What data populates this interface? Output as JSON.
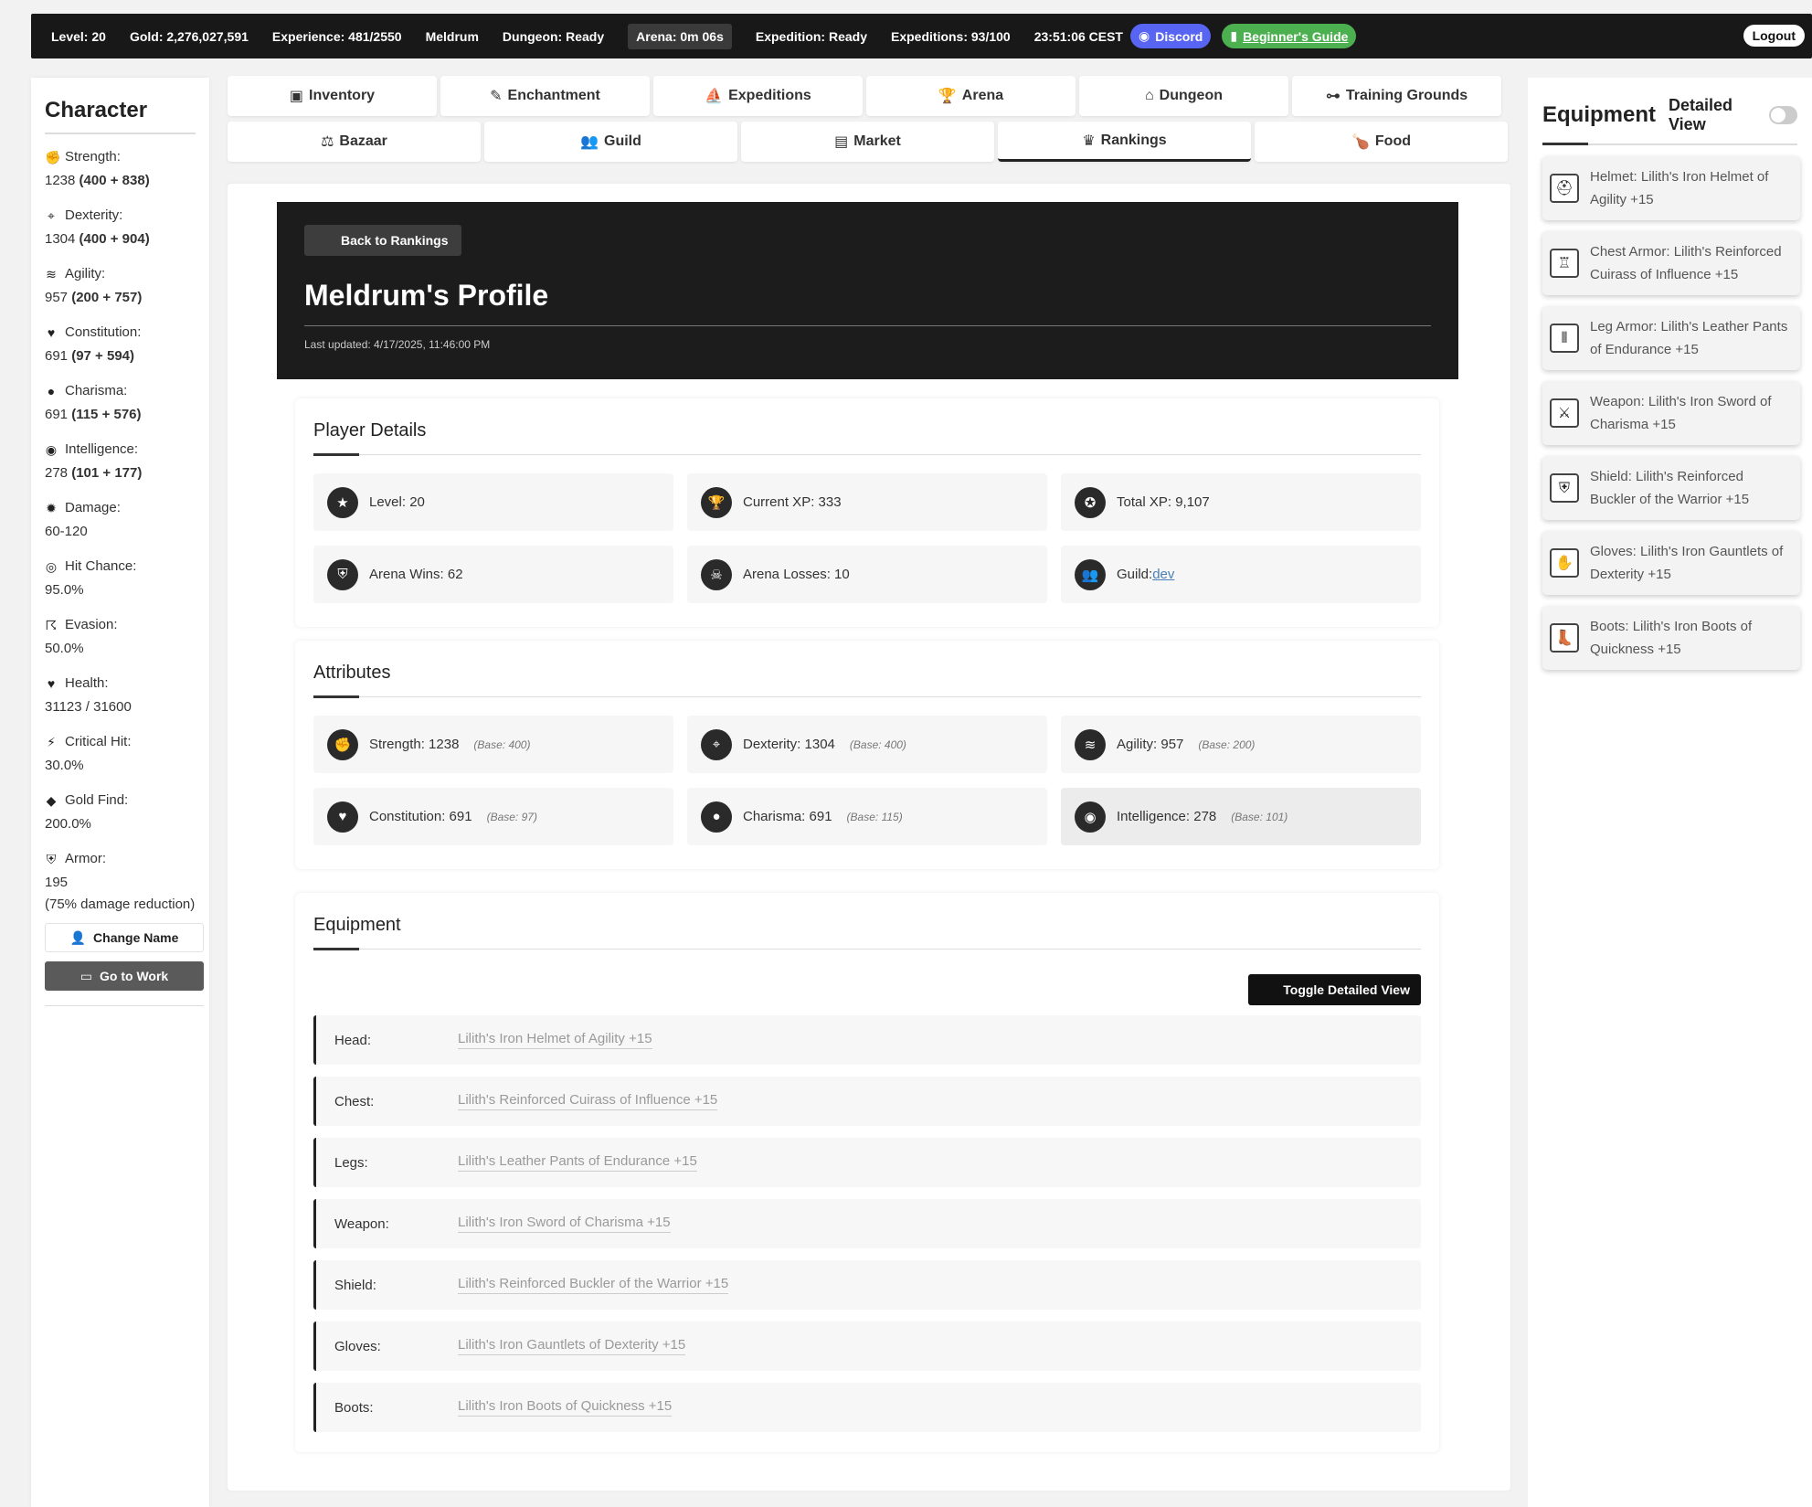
{
  "topbar": {
    "level": "Level: 20",
    "gold": "Gold: 2,276,027,591",
    "experience": "Experience: 481/2550",
    "player": "Meldrum",
    "dungeon": "Dungeon: Ready",
    "arena": "Arena: 0m 06s",
    "expedition": "Expedition: Ready",
    "expeditions": "Expeditions: 93/100",
    "time": "23:51:06 CEST",
    "discord": "Discord",
    "guide": "Beginner's Guide",
    "logout": "Logout"
  },
  "sidebar": {
    "title": "Character",
    "stats": [
      {
        "icon": "fist-icon",
        "glyph": "✊",
        "label": "Strength:",
        "value": "1238",
        "detail": "(400 + 838)"
      },
      {
        "icon": "crosshair-icon",
        "glyph": "⌖",
        "label": "Dexterity:",
        "value": "1304",
        "detail": "(400 + 904)"
      },
      {
        "icon": "wind-icon",
        "glyph": "≋",
        "label": "Agility:",
        "value": "957",
        "detail": "(200 + 757)"
      },
      {
        "icon": "heart-pulse-icon",
        "glyph": "♥",
        "label": "Constitution:",
        "value": "691",
        "detail": "(97 + 594)"
      },
      {
        "icon": "speech-bubble-icon",
        "glyph": "●",
        "label": "Charisma:",
        "value": "691",
        "detail": "(115 + 576)"
      },
      {
        "icon": "brain-icon",
        "glyph": "◉",
        "label": "Intelligence:",
        "value": "278",
        "detail": "(101 + 177)"
      },
      {
        "icon": "explosion-icon",
        "glyph": "✹",
        "label": "Damage:",
        "value": "60-120",
        "detail": ""
      },
      {
        "icon": "target-icon",
        "glyph": "◎",
        "label": "Hit Chance:",
        "value": "95.0%",
        "detail": ""
      },
      {
        "icon": "running-icon",
        "glyph": "☈",
        "label": "Evasion:",
        "value": "50.0%",
        "detail": ""
      },
      {
        "icon": "heart-icon",
        "glyph": "♥",
        "label": "Health:",
        "value": "31123 / 31600",
        "detail": ""
      },
      {
        "icon": "bolt-icon",
        "glyph": "⚡",
        "label": "Critical Hit:",
        "value": "30.0%",
        "detail": ""
      },
      {
        "icon": "gem-icon",
        "glyph": "◆",
        "label": "Gold Find:",
        "value": "200.0%",
        "detail": ""
      },
      {
        "icon": "shield-icon",
        "glyph": "⛨",
        "label": "Armor:",
        "value": "195",
        "detail": ""
      }
    ],
    "armor_note": "(75% damage reduction)",
    "change_name": "Change Name",
    "go_to_work": "Go to Work"
  },
  "nav": {
    "row1": [
      {
        "icon": "chest-icon",
        "glyph": "▣",
        "label": "Inventory"
      },
      {
        "icon": "pencil-icon",
        "glyph": "✎",
        "label": "Enchantment"
      },
      {
        "icon": "ship-icon",
        "glyph": "⛵",
        "label": "Expeditions"
      },
      {
        "icon": "trophy-icon",
        "glyph": "🏆",
        "label": "Arena"
      },
      {
        "icon": "dungeon-icon",
        "glyph": "⌂",
        "label": "Dungeon"
      },
      {
        "icon": "dumbbell-icon",
        "glyph": "⊶",
        "label": "Training Grounds"
      }
    ],
    "row2": [
      {
        "icon": "scale-icon",
        "glyph": "⚖",
        "label": "Bazaar"
      },
      {
        "icon": "users-icon",
        "glyph": "👥",
        "label": "Guild"
      },
      {
        "icon": "store-icon",
        "glyph": "▤",
        "label": "Market"
      },
      {
        "icon": "crown-icon",
        "glyph": "♛",
        "label": "Rankings"
      },
      {
        "icon": "drumstick-icon",
        "glyph": "🍗",
        "label": "Food"
      }
    ]
  },
  "profile": {
    "back": "Back to Rankings",
    "title": "Meldrum's Profile",
    "updated": "Last updated: 4/17/2025, 11:46:00 PM"
  },
  "player_details": {
    "title": "Player Details",
    "items": [
      {
        "icon": "star-icon",
        "glyph": "★",
        "text": "Level: 20"
      },
      {
        "icon": "trophy-icon",
        "glyph": "🏆",
        "text": "Current XP: 333"
      },
      {
        "icon": "medal-icon",
        "glyph": "✪",
        "text": "Total XP: 9,107"
      },
      {
        "icon": "shield-icon",
        "glyph": "⛨",
        "text": "Arena Wins: 62"
      },
      {
        "icon": "skull-icon",
        "glyph": "☠",
        "text": "Arena Losses: 10"
      }
    ],
    "guild_label": "Guild:",
    "guild_name": "dev"
  },
  "attributes": {
    "title": "Attributes",
    "items": [
      {
        "icon": "fist-icon",
        "glyph": "✊",
        "text": "Strength: 1238",
        "base": "(Base: 400)"
      },
      {
        "icon": "crosshair-icon",
        "glyph": "⌖",
        "text": "Dexterity: 1304",
        "base": "(Base: 400)"
      },
      {
        "icon": "wind-icon",
        "glyph": "≋",
        "text": "Agility: 957",
        "base": "(Base: 200)"
      },
      {
        "icon": "heart-pulse-icon",
        "glyph": "♥",
        "text": "Constitution: 691",
        "base": "(Base: 97)"
      },
      {
        "icon": "speech-bubble-icon",
        "glyph": "●",
        "text": "Charisma: 691",
        "base": "(Base: 115)"
      },
      {
        "icon": "brain-icon",
        "glyph": "◉",
        "text": "Intelligence: 278",
        "base": "(Base: 101)"
      }
    ]
  },
  "equipment": {
    "title": "Equipment",
    "toggle": "Toggle Detailed View",
    "rows": [
      {
        "slot": "Head:",
        "item": "Lilith's Iron Helmet of Agility +15"
      },
      {
        "slot": "Chest:",
        "item": "Lilith's Reinforced Cuirass of Influence +15"
      },
      {
        "slot": "Legs:",
        "item": "Lilith's Leather Pants of Endurance +15"
      },
      {
        "slot": "Weapon:",
        "item": "Lilith's Iron Sword of Charisma +15"
      },
      {
        "slot": "Shield:",
        "item": "Lilith's Reinforced Buckler of the Warrior +15"
      },
      {
        "slot": "Gloves:",
        "item": "Lilith's Iron Gauntlets of Dexterity +15"
      },
      {
        "slot": "Boots:",
        "item": "Lilith's Iron Boots of Quickness +15"
      }
    ]
  },
  "right_panel": {
    "title": "Equipment",
    "detailed_view": "Detailed View",
    "items": [
      {
        "icon": "helmet-icon",
        "glyph": "⛑",
        "text": "Helmet: Lilith's Iron Helmet of Agility +15"
      },
      {
        "icon": "chest-armor-icon",
        "glyph": "♖",
        "text": "Chest Armor: Lilith's Reinforced Cuirass of Influence +15"
      },
      {
        "icon": "leg-armor-icon",
        "glyph": "⫴",
        "text": "Leg Armor: Lilith's Leather Pants of Endurance +15"
      },
      {
        "icon": "sword-icon",
        "glyph": "⚔",
        "text": "Weapon: Lilith's Iron Sword of Charisma +15"
      },
      {
        "icon": "shield-icon",
        "glyph": "⛨",
        "text": "Shield: Lilith's Reinforced Buckler of the Warrior +15"
      },
      {
        "icon": "gloves-icon",
        "glyph": "✋",
        "text": "Gloves: Lilith's Iron Gauntlets of Dexterity +15"
      },
      {
        "icon": "boots-icon",
        "glyph": "👢",
        "text": "Boots: Lilith's Iron Boots of Quickness +15"
      }
    ]
  },
  "colors": {
    "topbar": "#181818",
    "discord": "#5865f2",
    "guide": "#4caf50",
    "link": "#4a7fb8"
  }
}
